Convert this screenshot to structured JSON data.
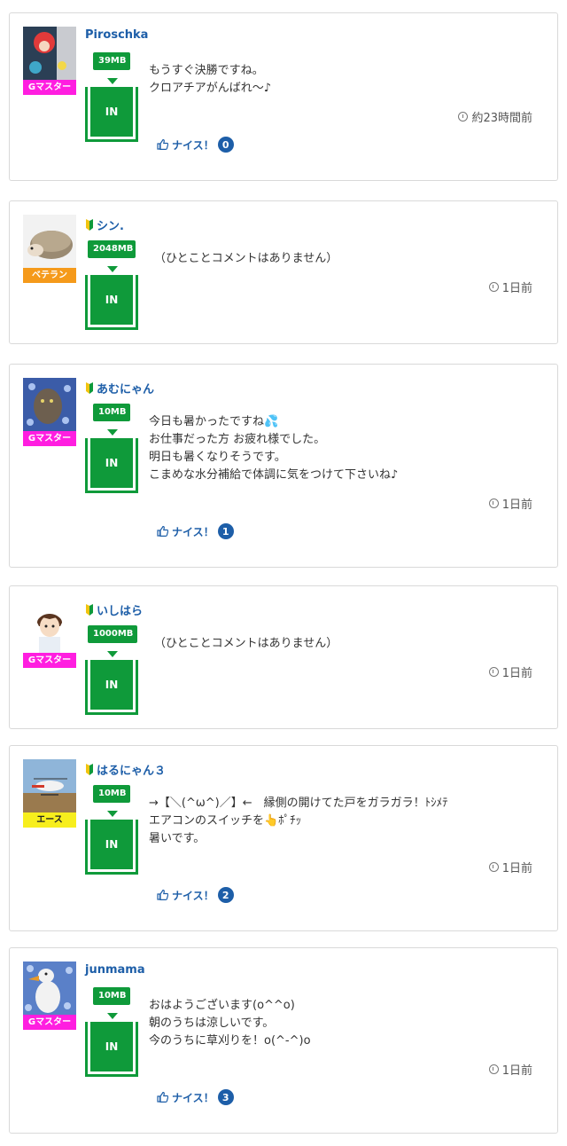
{
  "posts": [
    {
      "username": "Piroschka",
      "rank": "Gマスター",
      "mb": "39MB",
      "status": "IN",
      "message": "もうすぐ決勝ですね。\nクロアチアがんばれ〜♪",
      "time": "約23時間前",
      "nice_label": "ナイス！",
      "nice_count": "0"
    },
    {
      "username": "シン.",
      "rank": "ベテラン",
      "mb": "2048MB",
      "status": "IN",
      "message": "（ひとことコメントはありません）",
      "time": "1日前"
    },
    {
      "username": "あむにゃん",
      "rank": "Gマスター",
      "mb": "10MB",
      "status": "IN",
      "message": "今日も暑かったですね💦\nお仕事だった方 お疲れ様でした。\n明日も暑くなりそうです。\nこまめな水分補給で体調に気をつけて下さいね♪",
      "time": "1日前",
      "nice_label": "ナイス！",
      "nice_count": "1"
    },
    {
      "username": "いしはら",
      "rank": "Gマスター",
      "mb": "1000MB",
      "status": "IN",
      "message": "（ひとことコメントはありません）",
      "time": "1日前"
    },
    {
      "username": "はるにゃん３",
      "rank": "エース",
      "mb": "10MB",
      "status": "IN",
      "message": "→【＼(^ω^)／】←　縁側の開けてた戸をガラガラ！ﾄｼﾒﾃ\nエアコンのスイッチを👆ﾎﾟﾁｯ\n暑いです。",
      "time": "1日前",
      "nice_label": "ナイス！",
      "nice_count": "2"
    },
    {
      "username": "junmama",
      "rank": "Gマスター",
      "mb": "10MB",
      "status": "IN",
      "message": "おはようございます(o^^o)\n朝のうちは涼しいです。\n今のうちに草刈りを！o(^-^)o",
      "time": "1日前",
      "nice_label": "ナイス！",
      "nice_count": "3"
    }
  ]
}
